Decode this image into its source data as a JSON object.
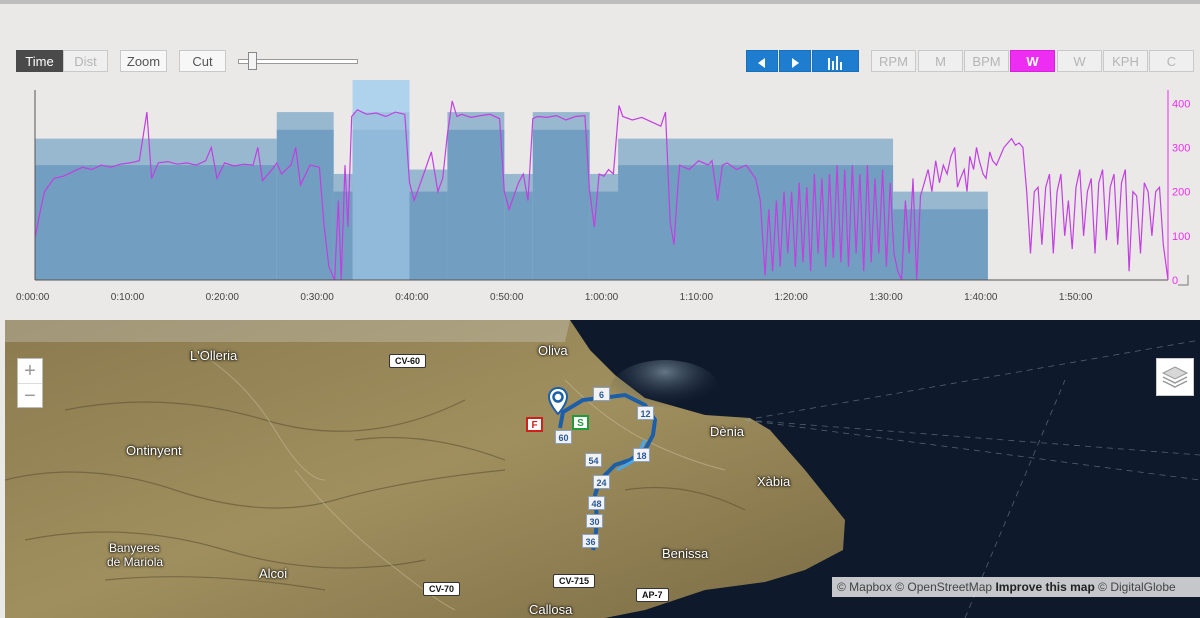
{
  "toolbar": {
    "time_label": "Time",
    "dist_label": "Dist",
    "zoom_label": "Zoom",
    "cut_label": "Cut",
    "prev_icon": "triangle-left-icon",
    "next_icon": "triangle-right-icon",
    "bars_icon": "bar-chart-icon",
    "metrics": [
      "RPM",
      "M",
      "BPM",
      "W",
      "W",
      "KPH",
      "C"
    ],
    "active_metric_index": 3,
    "slider_position": 0.12,
    "colors": {
      "active": "#4a4a4a",
      "blue": "#1f7dd0",
      "magenta": "#ee2df2"
    }
  },
  "chart_data": {
    "type": "area",
    "x_unit": "minutes",
    "x_ticks": [
      "0:00:00",
      "0:10:00",
      "0:20:00",
      "0:30:00",
      "0:40:00",
      "0:50:00",
      "1:00:00",
      "1:10:00",
      "1:20:00",
      "1:30:00",
      "1:40:00",
      "1:50:00"
    ],
    "y_ticks": [
      "0",
      "100",
      "200",
      "300",
      "400"
    ],
    "ylim": [
      0,
      430
    ],
    "xlim": [
      0,
      119.5
    ],
    "axis_color": "#ee2df2",
    "bands": [
      {
        "start": 0,
        "end": 25.5,
        "upper": 320,
        "lower": 260
      },
      {
        "start": 25.5,
        "end": 31.5,
        "upper": 380,
        "lower": 340
      },
      {
        "start": 31.5,
        "end": 33.5,
        "upper": 240,
        "lower": 200
      },
      {
        "start": 33.5,
        "end": 39.5,
        "upper": 380,
        "lower": 340
      },
      {
        "start": 39.5,
        "end": 43.5,
        "upper": 250,
        "lower": 200
      },
      {
        "start": 43.5,
        "end": 49.5,
        "upper": 380,
        "lower": 340
      },
      {
        "start": 49.5,
        "end": 52.5,
        "upper": 240,
        "lower": 200
      },
      {
        "start": 52.5,
        "end": 58.5,
        "upper": 380,
        "lower": 340
      },
      {
        "start": 58.5,
        "end": 61.5,
        "upper": 240,
        "lower": 200
      },
      {
        "start": 61.5,
        "end": 90.5,
        "upper": 320,
        "lower": 260
      },
      {
        "start": 90.5,
        "end": 100.5,
        "upper": 200,
        "lower": 160
      }
    ],
    "highlight": {
      "start": 33.5,
      "end": 39.5
    },
    "series": [
      {
        "values": [
          [
            0,
            95
          ],
          [
            0.5,
            150
          ],
          [
            1,
            200
          ],
          [
            2,
            230
          ],
          [
            3,
            235
          ],
          [
            4,
            245
          ],
          [
            5,
            255
          ],
          [
            6,
            250
          ],
          [
            7,
            260
          ],
          [
            8,
            255
          ],
          [
            9,
            262
          ],
          [
            10,
            265
          ],
          [
            11,
            270
          ],
          [
            11.8,
            380
          ],
          [
            12.3,
            230
          ],
          [
            13,
            265
          ],
          [
            14,
            268
          ],
          [
            15,
            262
          ],
          [
            16,
            265
          ],
          [
            17,
            260
          ],
          [
            18,
            270
          ],
          [
            18.6,
            300
          ],
          [
            19.2,
            230
          ],
          [
            20,
            265
          ],
          [
            21,
            258
          ],
          [
            22,
            262
          ],
          [
            23,
            260
          ],
          [
            23.5,
            300
          ],
          [
            24,
            225
          ],
          [
            25,
            250
          ],
          [
            25.5,
            265
          ],
          [
            26,
            240
          ],
          [
            27,
            260
          ],
          [
            27.5,
            300
          ],
          [
            28,
            215
          ],
          [
            29,
            260
          ],
          [
            30,
            255
          ],
          [
            30.5,
            120
          ],
          [
            31,
            30
          ],
          [
            31.6,
            0
          ],
          [
            32,
            180
          ],
          [
            32.3,
            0
          ],
          [
            32.7,
            260
          ],
          [
            33,
            120
          ],
          [
            33.4,
            370
          ],
          [
            34,
            385
          ],
          [
            35,
            375
          ],
          [
            36,
            378
          ],
          [
            37,
            370
          ],
          [
            38,
            380
          ],
          [
            39,
            375
          ],
          [
            39.5,
            220
          ],
          [
            40,
            180
          ],
          [
            41,
            240
          ],
          [
            41.8,
            290
          ],
          [
            42.5,
            200
          ],
          [
            43,
            230
          ],
          [
            43.5,
            330
          ],
          [
            44,
            405
          ],
          [
            44.5,
            370
          ],
          [
            45,
            375
          ],
          [
            46,
            368
          ],
          [
            47,
            372
          ],
          [
            48,
            375
          ],
          [
            49,
            365
          ],
          [
            49.5,
            200
          ],
          [
            50,
            160
          ],
          [
            51,
            220
          ],
          [
            51.5,
            240
          ],
          [
            52,
            180
          ],
          [
            52.5,
            365
          ],
          [
            53,
            370
          ],
          [
            54,
            368
          ],
          [
            55,
            372
          ],
          [
            56,
            362
          ],
          [
            57,
            370
          ],
          [
            58,
            372
          ],
          [
            58.5,
            200
          ],
          [
            59,
            120
          ],
          [
            59.5,
            240
          ],
          [
            60,
            235
          ],
          [
            60.5,
            250
          ],
          [
            61,
            240
          ],
          [
            61.6,
            395
          ],
          [
            62,
            370
          ],
          [
            63,
            362
          ],
          [
            64,
            368
          ],
          [
            65,
            358
          ],
          [
            66,
            348
          ],
          [
            66.5,
            380
          ],
          [
            67,
            130
          ],
          [
            67.4,
            80
          ],
          [
            67.8,
            210
          ],
          [
            68,
            260
          ],
          [
            69,
            250
          ],
          [
            70,
            270
          ],
          [
            71,
            260
          ],
          [
            71.4,
            270
          ],
          [
            72,
            180
          ],
          [
            72.5,
            260
          ],
          [
            73,
            265
          ],
          [
            74,
            250
          ],
          [
            75,
            260
          ],
          [
            76,
            230
          ],
          [
            76.5,
            180
          ],
          [
            77,
            10
          ],
          [
            77.4,
            160
          ],
          [
            77.8,
            20
          ],
          [
            78.2,
            180
          ],
          [
            78.6,
            30
          ],
          [
            79,
            200
          ],
          [
            79.4,
            60
          ],
          [
            79.8,
            200
          ],
          [
            80.2,
            30
          ],
          [
            80.6,
            220
          ],
          [
            81,
            40
          ],
          [
            81.4,
            210
          ],
          [
            81.8,
            20
          ],
          [
            82.2,
            240
          ],
          [
            82.6,
            60
          ],
          [
            83,
            230
          ],
          [
            83.4,
            30
          ],
          [
            83.8,
            240
          ],
          [
            84.2,
            50
          ],
          [
            84.6,
            260
          ],
          [
            85,
            40
          ],
          [
            85.4,
            250
          ],
          [
            85.8,
            30
          ],
          [
            86.2,
            260
          ],
          [
            86.6,
            60
          ],
          [
            87,
            240
          ],
          [
            87.4,
            20
          ],
          [
            87.8,
            260
          ],
          [
            88.2,
            40
          ],
          [
            88.6,
            230
          ],
          [
            89,
            60
          ],
          [
            89.4,
            250
          ],
          [
            89.8,
            30
          ],
          [
            90.2,
            220
          ],
          [
            90.6,
            60
          ],
          [
            91,
            20
          ],
          [
            91.4,
            0
          ],
          [
            91.8,
            180
          ],
          [
            92.2,
            60
          ],
          [
            92.6,
            230
          ],
          [
            93,
            0
          ],
          [
            93.4,
            190
          ],
          [
            93.8,
            220
          ],
          [
            94.2,
            250
          ],
          [
            94.6,
            200
          ],
          [
            95,
            270
          ],
          [
            95.4,
            220
          ],
          [
            95.8,
            260
          ],
          [
            96.2,
            240
          ],
          [
            96.6,
            280
          ],
          [
            97,
            300
          ],
          [
            97.3,
            210
          ],
          [
            97.6,
            230
          ],
          [
            98,
            250
          ],
          [
            98.3,
            200
          ],
          [
            98.6,
            280
          ],
          [
            99,
            250
          ],
          [
            99.3,
            300
          ],
          [
            99.6,
            270
          ],
          [
            100,
            240
          ],
          [
            100.3,
            230
          ],
          [
            100.7,
            290
          ],
          [
            101,
            270
          ],
          [
            101.4,
            260
          ],
          [
            101.8,
            280
          ],
          [
            102.2,
            300
          ],
          [
            102.6,
            310
          ],
          [
            103,
            320
          ],
          [
            103.4,
            305
          ],
          [
            103.8,
            310
          ],
          [
            104.2,
            300
          ],
          [
            104.6,
            200
          ],
          [
            105,
            60
          ],
          [
            105.4,
            200
          ],
          [
            105.8,
            210
          ],
          [
            106.2,
            80
          ],
          [
            106.6,
            210
          ],
          [
            107,
            240
          ],
          [
            107.4,
            60
          ],
          [
            107.8,
            200
          ],
          [
            108.2,
            240
          ],
          [
            108.6,
            100
          ],
          [
            109,
            180
          ],
          [
            109.4,
            70
          ],
          [
            109.8,
            210
          ],
          [
            110.2,
            250
          ],
          [
            110.6,
            100
          ],
          [
            111,
            200
          ],
          [
            111.4,
            230
          ],
          [
            111.8,
            60
          ],
          [
            112.2,
            220
          ],
          [
            112.6,
            250
          ],
          [
            113,
            90
          ],
          [
            113.4,
            210
          ],
          [
            113.8,
            240
          ],
          [
            114.2,
            80
          ],
          [
            114.6,
            220
          ],
          [
            115,
            250
          ],
          [
            115.4,
            20
          ],
          [
            115.8,
            200
          ],
          [
            116.2,
            190
          ],
          [
            116.6,
            60
          ],
          [
            117,
            220
          ],
          [
            117.4,
            200
          ],
          [
            117.8,
            100
          ],
          [
            118.2,
            200
          ],
          [
            118.6,
            210
          ],
          [
            119,
            80
          ],
          [
            119.5,
            0
          ]
        ]
      }
    ]
  },
  "map": {
    "zoom_in": "+",
    "zoom_out": "−",
    "layers_icon": "layers-icon",
    "places": [
      "Oliva",
      "L'Olleria",
      "Ontinyent",
      "Dènia",
      "Xàbia",
      "Benissa",
      "Alcoi",
      "Banyeres",
      "de Mariola",
      "Callosa"
    ],
    "roads": [
      "CV-60",
      "CV-70",
      "CV-715",
      "AP-7"
    ],
    "km_markers": [
      "6",
      "12",
      "18",
      "24",
      "30",
      "36",
      "48",
      "54",
      "60"
    ],
    "marker_finish": "F",
    "marker_start": "S",
    "attribution": {
      "mapbox": "© Mapbox",
      "osm": "© OpenStreetMap",
      "improve": "Improve this map",
      "digitalglobe": "© DigitalGlobe"
    }
  }
}
